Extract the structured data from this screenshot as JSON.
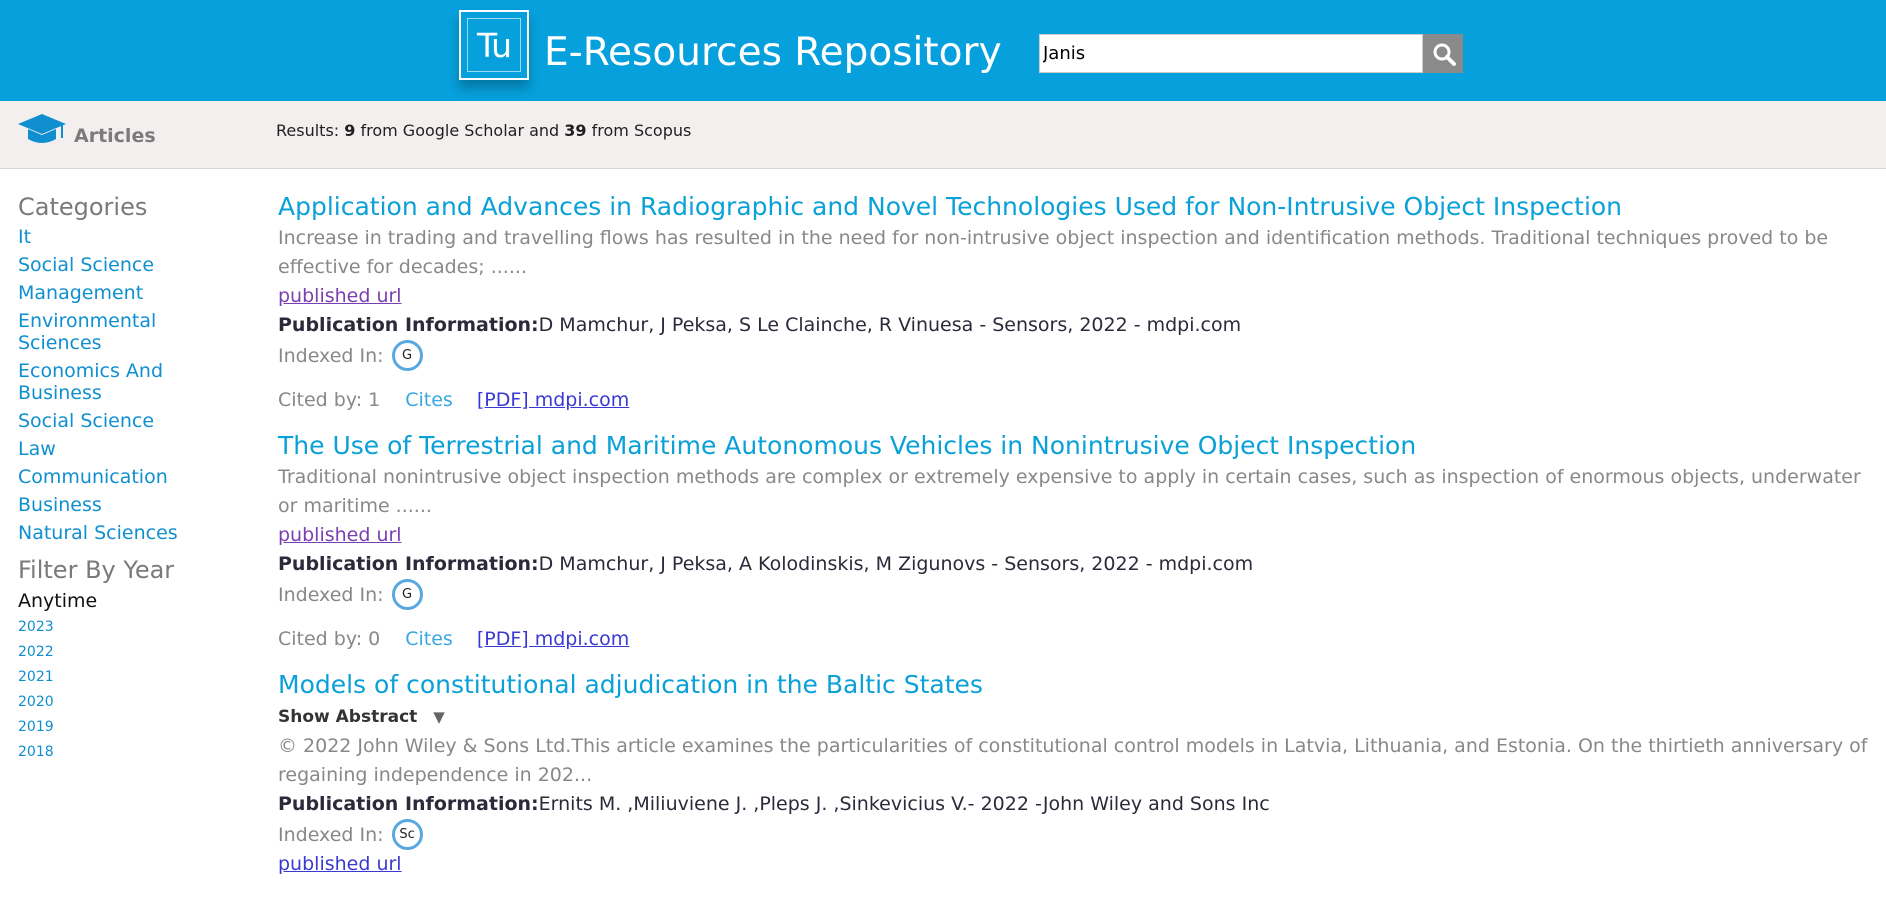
{
  "header": {
    "logo_text": "Tu",
    "title": "E-Resources Repository",
    "search_value": "Janis",
    "search_icon": "search-icon"
  },
  "subbar": {
    "section_icon": "graduation-cap-icon",
    "section_title": "Articles",
    "results_prefix": "Results: ",
    "scholar_count": "9",
    "scholar_text": " from Google Scholar and ",
    "scopus_count": "39",
    "scopus_text": " from Scopus"
  },
  "sidebar": {
    "categories_heading": "Categories",
    "categories": [
      "It",
      "Social Science",
      "Management",
      "Environmental Sciences",
      "Economics And Business",
      "Social Science",
      "Law",
      "Communication",
      "Business",
      "Natural Sciences"
    ],
    "filter_heading": "Filter By Year",
    "anytime": "Anytime",
    "years": [
      "2023",
      "2022",
      "2021",
      "2020",
      "2019",
      "2018"
    ]
  },
  "articles": [
    {
      "title": "Application and Advances in Radiographic and Novel Technologies Used for Non-Intrusive Object Inspection",
      "abstract": "Increase in trading and travelling flows has resulted in the need for non-intrusive object inspection and identification methods. Traditional techniques proved to be effective for decades; ......",
      "published_url": "published url",
      "pub_label": "Publication Information:",
      "pub_info": "D Mamchur, J Peksa, S Le Clainche, R Vinuesa - Sensors, 2022 - mdpi.com",
      "indexed_label": "Indexed In:",
      "indexed_badge": "G",
      "cited_by": "Cited by: 1",
      "cites": "Cites",
      "pdf": "[PDF] mdpi.com"
    },
    {
      "title": "The Use of Terrestrial and Maritime Autonomous Vehicles in Nonintrusive Object Inspection",
      "abstract": "Traditional nonintrusive object inspection methods are complex or extremely expensive to apply in certain cases, such as inspection of enormous objects, underwater or maritime ......",
      "published_url": "published url",
      "pub_label": "Publication Information:",
      "pub_info": "D Mamchur, J Peksa, A Kolodinskis, M Zigunovs - Sensors, 2022 - mdpi.com",
      "indexed_label": "Indexed In:",
      "indexed_badge": "G",
      "cited_by": "Cited by: 0",
      "cites": "Cites",
      "pdf": "[PDF] mdpi.com"
    },
    {
      "title": "Models of constitutional adjudication in the Baltic States",
      "show_abstract": "Show Abstract",
      "abstract": "© 2022 John Wiley & Sons Ltd.This article examines the particularities of constitutional control models in Latvia, Lithuania, and Estonia. On the thirtieth anniversary of regaining independence in 202...",
      "pub_label": "Publication Information:",
      "pub_info": "Ernits M. ,Miliuviene J. ,Pleps J. ,Sinkevicius V.- 2022 -John Wiley and Sons Inc",
      "indexed_label": "Indexed In:",
      "indexed_badge": "Sc",
      "published_url": "published url"
    }
  ]
}
